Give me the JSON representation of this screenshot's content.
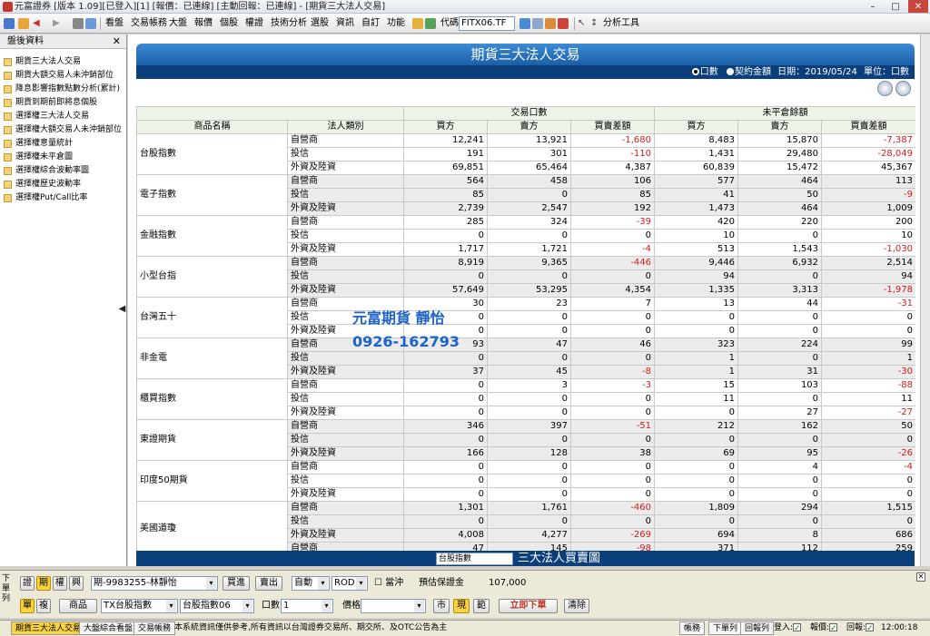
{
  "window": {
    "title": "元富證券 [版本 1.09][已登入][1] [報價：已連線] [主動回報：已連線] - [期貨三大法人交易]"
  },
  "toolbar": {
    "menus": [
      "看盤",
      "交易帳務",
      "大盤",
      "報價",
      "個股",
      "權證",
      "技術分析",
      "選股",
      "資訊",
      "自訂",
      "功能"
    ],
    "code_label": "代碼",
    "code_value": "FITX06.TF",
    "analysis_tools": "分析工具"
  },
  "sidebar": {
    "title": "盤後資料",
    "items": [
      "期貨三大法人交易",
      "期貨大額交易人未沖銷部位",
      "降息影響指數點數分析(累計)",
      "期貨到期前即將息個股",
      "選擇權三大法人交易",
      "選擇權大額交易人未沖銷部位",
      "選擇權意量統計",
      "選擇權未平倉圖",
      "選擇權綜合波動率圖",
      "選擇權歷史波動率",
      "選擇權Put/Call比率"
    ]
  },
  "report": {
    "title": "期貨三大法人交易",
    "radio_contracts": "口數",
    "radio_amount": "契約金額",
    "date_text": "日期：2019/05/24",
    "unit_text": "單位：口數",
    "group_trade": "交易口數",
    "group_oi": "未平倉餘額",
    "col_product": "商品名稱",
    "col_type": "法人類別",
    "col_buy": "買方",
    "col_sell": "賣方",
    "col_diff": "買賣差額",
    "rows": [
      {
        "product": "台股指數",
        "data": [
          [
            "自營商",
            "12,241",
            "13,921",
            "-1,680",
            "8,483",
            "15,870",
            "-7,387"
          ],
          [
            "投信",
            "191",
            "301",
            "-110",
            "1,431",
            "29,480",
            "-28,049"
          ],
          [
            "外資及陸資",
            "69,851",
            "65,464",
            "4,387",
            "60,839",
            "15,472",
            "45,367"
          ]
        ]
      },
      {
        "product": "電子指數",
        "data": [
          [
            "自營商",
            "564",
            "458",
            "106",
            "577",
            "464",
            "113"
          ],
          [
            "投信",
            "85",
            "0",
            "85",
            "41",
            "50",
            "-9"
          ],
          [
            "外資及陸資",
            "2,739",
            "2,547",
            "192",
            "1,473",
            "464",
            "1,009"
          ]
        ]
      },
      {
        "product": "金融指數",
        "data": [
          [
            "自營商",
            "285",
            "324",
            "-39",
            "420",
            "220",
            "200"
          ],
          [
            "投信",
            "0",
            "0",
            "0",
            "10",
            "0",
            "10"
          ],
          [
            "外資及陸資",
            "1,717",
            "1,721",
            "-4",
            "513",
            "1,543",
            "-1,030"
          ]
        ]
      },
      {
        "product": "小型台指",
        "data": [
          [
            "自營商",
            "8,919",
            "9,365",
            "-446",
            "9,446",
            "6,932",
            "2,514"
          ],
          [
            "投信",
            "0",
            "0",
            "0",
            "94",
            "0",
            "94"
          ],
          [
            "外資及陸資",
            "57,649",
            "53,295",
            "4,354",
            "1,335",
            "3,313",
            "-1,978"
          ]
        ]
      },
      {
        "product": "台灣五十",
        "data": [
          [
            "自營商",
            "30",
            "23",
            "7",
            "13",
            "44",
            "-31"
          ],
          [
            "投信",
            "0",
            "0",
            "0",
            "0",
            "0",
            "0"
          ],
          [
            "外資及陸資",
            "0",
            "0",
            "0",
            "0",
            "0",
            "0"
          ]
        ]
      },
      {
        "product": "非金電",
        "data": [
          [
            "自營商",
            "93",
            "47",
            "46",
            "323",
            "224",
            "99"
          ],
          [
            "投信",
            "0",
            "0",
            "0",
            "1",
            "0",
            "1"
          ],
          [
            "外資及陸資",
            "37",
            "45",
            "-8",
            "1",
            "31",
            "-30"
          ]
        ]
      },
      {
        "product": "櫃買指數",
        "data": [
          [
            "自營商",
            "0",
            "3",
            "-3",
            "15",
            "103",
            "-88"
          ],
          [
            "投信",
            "0",
            "0",
            "0",
            "11",
            "0",
            "11"
          ],
          [
            "外資及陸資",
            "0",
            "0",
            "0",
            "0",
            "27",
            "-27"
          ]
        ]
      },
      {
        "product": "東證期貨",
        "data": [
          [
            "自營商",
            "346",
            "397",
            "-51",
            "212",
            "162",
            "50"
          ],
          [
            "投信",
            "0",
            "0",
            "0",
            "0",
            "0",
            "0"
          ],
          [
            "外資及陸資",
            "166",
            "128",
            "38",
            "69",
            "95",
            "-26"
          ]
        ]
      },
      {
        "product": "印度50期貨",
        "data": [
          [
            "自營商",
            "0",
            "0",
            "0",
            "0",
            "4",
            "-4"
          ],
          [
            "投信",
            "0",
            "0",
            "0",
            "0",
            "0",
            "0"
          ],
          [
            "外資及陸資",
            "0",
            "0",
            "0",
            "0",
            "0",
            "0"
          ]
        ]
      },
      {
        "product": "美國道瓊",
        "data": [
          [
            "自營商",
            "1,301",
            "1,761",
            "-460",
            "1,809",
            "294",
            "1,515"
          ],
          [
            "投信",
            "0",
            "0",
            "0",
            "0",
            "0",
            "0"
          ],
          [
            "外資及陸資",
            "4,008",
            "4,277",
            "-269",
            "694",
            "8",
            "686"
          ],
          [
            "自營商",
            "47",
            "145",
            "-98",
            "371",
            "112",
            "259"
          ]
        ]
      }
    ],
    "footer_select": "台股指數",
    "footer_title": "三大法人買賣圖"
  },
  "watermark": {
    "line1": "元富期貨 靜怡",
    "line2": "0926-162793"
  },
  "order": {
    "side_label": "下單列",
    "tabs": [
      "證",
      "期",
      "權",
      "興"
    ],
    "account": "期-9983255-林靜怡",
    "buy_btn": "買進",
    "sell_btn": "賣出",
    "auto": "自動",
    "rod": "ROD",
    "daytrade": "當沖",
    "margin_label": "預估保證金",
    "margin_value": "107,000",
    "single": "單",
    "multi": "複",
    "product_btn": "商品",
    "product_select": "TX台股指數",
    "contract_select": "台股指數06",
    "qty_label": "口數",
    "qty_value": "1",
    "price_label": "價格",
    "market_btn": "市",
    "limit_btn": "現",
    "range_btn": "範",
    "submit": "立即下單",
    "clear": "清除"
  },
  "status": {
    "tabs": [
      "期貨三大法人交易",
      "大盤綜合看盤",
      "交易帳務"
    ],
    "notice": "本系統資訊僅供參考,所有資訊以台灣證券交易所、期交所、及OTC公告為主",
    "right": [
      "帳務",
      "下單列",
      "回報列"
    ],
    "login": "登入:",
    "quote": "報價:",
    "report": "回報:",
    "time": "12:00:18"
  },
  "colors": {
    "header_blue": "#1a5fa6",
    "navy": "#0b3f7c",
    "negative": "#d21b1b",
    "watermark": "#1e63c7",
    "highlight": "#f7d342"
  }
}
